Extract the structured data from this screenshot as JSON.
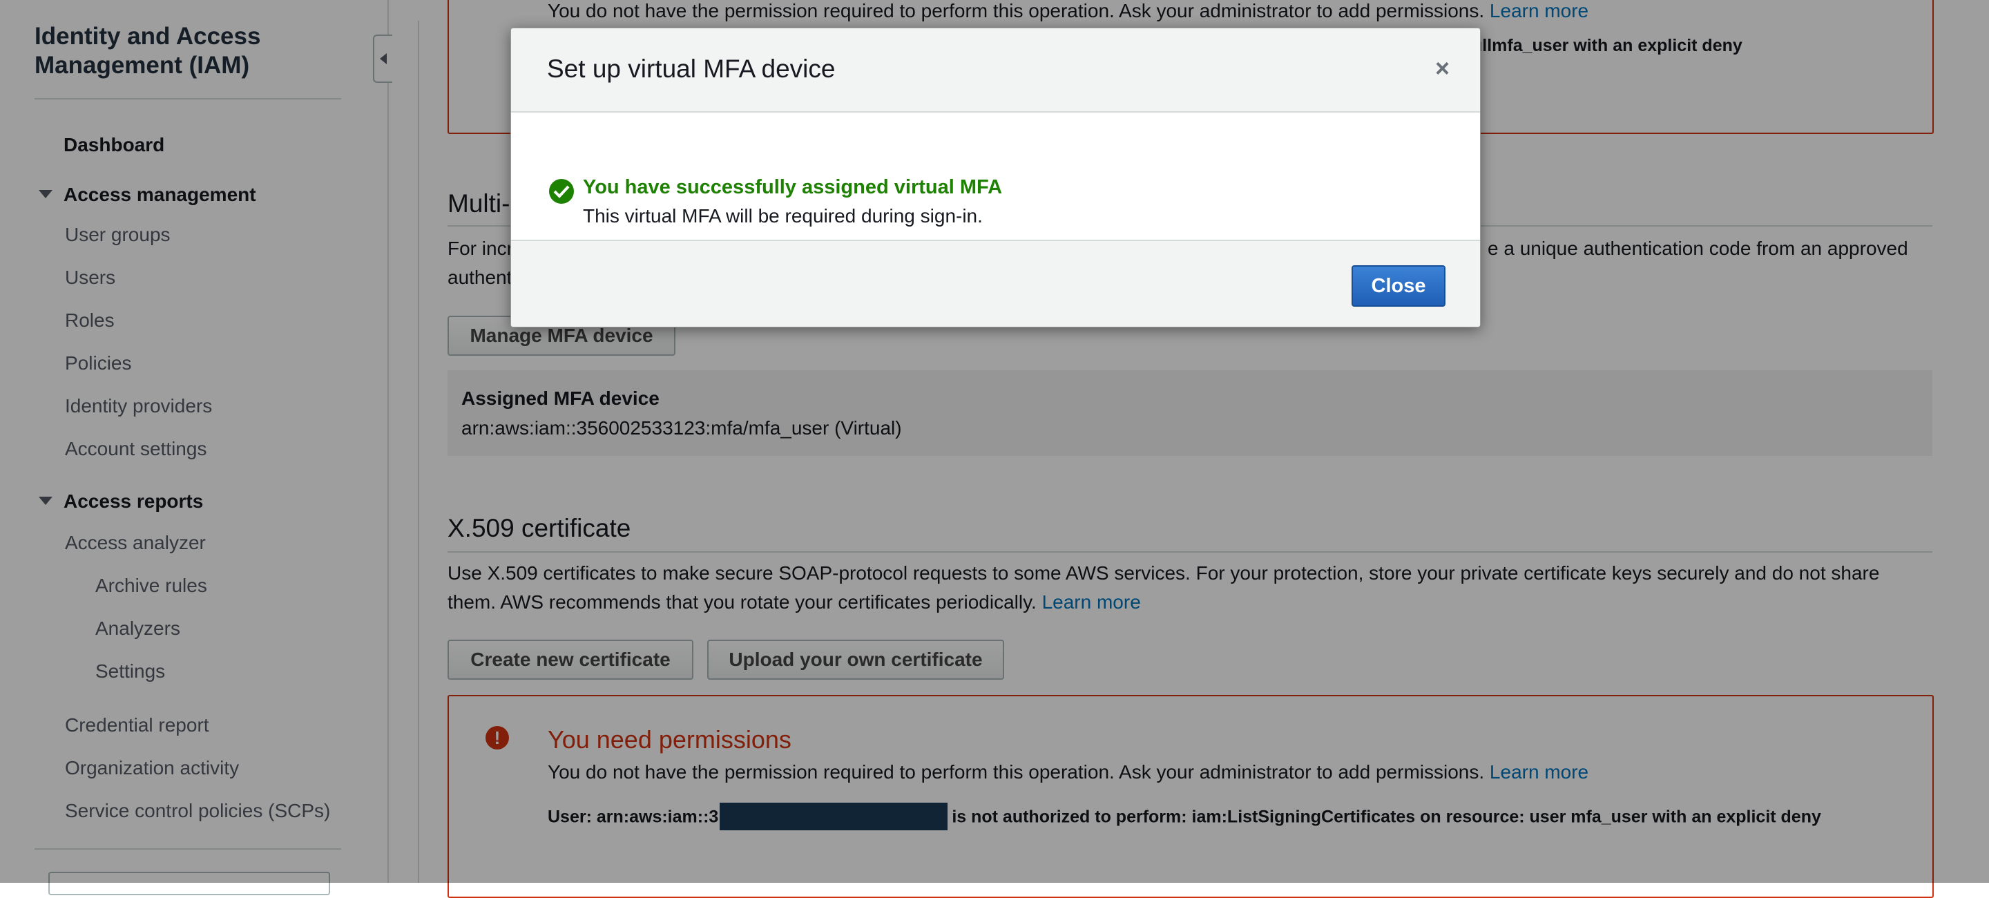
{
  "sidebar": {
    "title": "Identity and Access Management (IAM)",
    "dashboard": "Dashboard",
    "access_management": {
      "label": "Access management",
      "items": [
        "User groups",
        "Users",
        "Roles",
        "Policies",
        "Identity providers",
        "Account settings"
      ]
    },
    "access_reports": {
      "label": "Access reports",
      "items": [
        "Access analyzer",
        "Archive rules",
        "Analyzers",
        "Settings",
        "Credential report",
        "Organization activity",
        "Service control policies (SCPs)"
      ]
    }
  },
  "top_error": {
    "message": "You do not have the permission required to perform this operation. Ask your administrator to add permissions.",
    "learn_more": "Learn more",
    "detail_tail": "ullmfa_user with an explicit deny"
  },
  "mfa_section": {
    "heading": "Multi-",
    "desc_start_line1": "For incr",
    "desc_start_line2": "authent",
    "desc_end_line1": "e a unique authentication code from an approved",
    "manage_button": "Manage MFA device",
    "assigned_label": "Assigned MFA device",
    "assigned_value": "arn:aws:iam::356002533123:mfa/mfa_user (Virtual)"
  },
  "x509_section": {
    "heading": "X.509 certificate",
    "desc_line1": "Use X.509 certificates to make secure SOAP-protocol requests to some AWS services. For your protection, store your private certificate keys securely and do not share",
    "desc_line2": "them. AWS recommends that you rotate your certificates periodically.",
    "learn_more": "Learn more",
    "create_button": "Create new certificate",
    "upload_button": "Upload your own certificate"
  },
  "bottom_error": {
    "title": "You need permissions",
    "message": "You do not have the permission required to perform this operation. Ask your administrator to add permissions.",
    "learn_more": "Learn more",
    "detail_prefix": "User: arn:aws:iam::3",
    "detail_suffix": "is not authorized to perform: iam:ListSigningCertificates on resource: user mfa_user with an explicit deny"
  },
  "modal": {
    "title": "Set up virtual MFA device",
    "close_x": "×",
    "success_title": "You have successfully assigned virtual MFA",
    "success_desc": "This virtual MFA will be required during sign-in.",
    "close_button": "Close"
  },
  "colors": {
    "link": "#0073bb",
    "error": "#d13212",
    "success": "#1d8102",
    "primary_button": "#1f5fb5"
  }
}
